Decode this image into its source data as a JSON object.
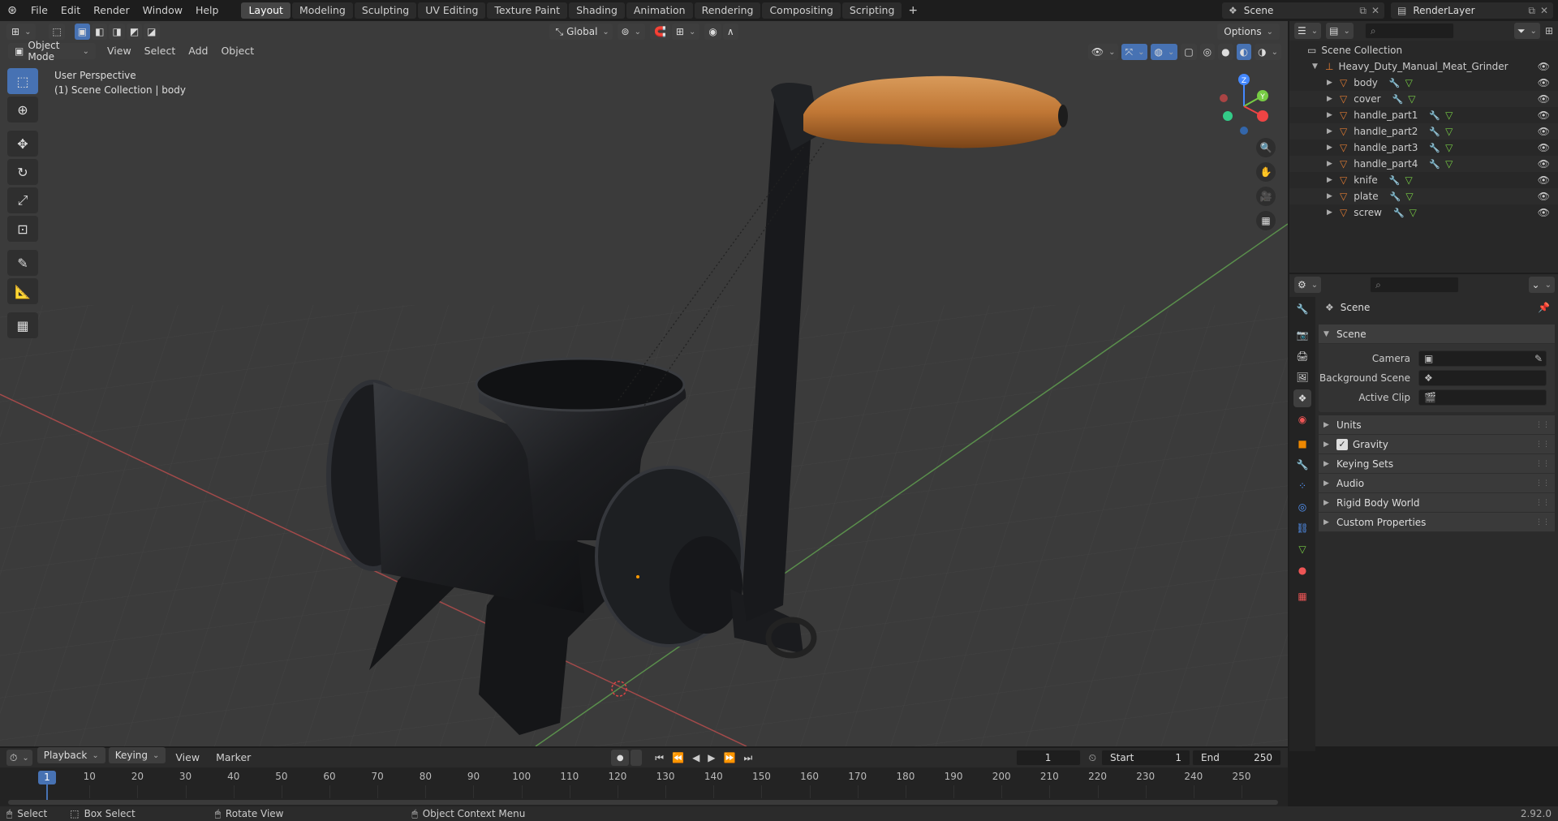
{
  "topbar": {
    "menus": [
      "File",
      "Edit",
      "Render",
      "Window",
      "Help"
    ],
    "workspaces": [
      "Layout",
      "Modeling",
      "Sculpting",
      "UV Editing",
      "Texture Paint",
      "Shading",
      "Animation",
      "Rendering",
      "Compositing",
      "Scripting"
    ],
    "active_workspace": "Layout",
    "add_tab": "+",
    "scene": "Scene",
    "view_layer": "RenderLayer"
  },
  "viewport": {
    "mode": "Object Mode",
    "menus": [
      "View",
      "Select",
      "Add",
      "Object"
    ],
    "orientation": "Global",
    "options": "Options",
    "info_line1": "User Perspective",
    "info_line2": "(1) Scene Collection | body",
    "gizmo": {
      "z": "Z",
      "y": "Y"
    }
  },
  "outliner": {
    "root": "Scene Collection",
    "collection": "Heavy_Duty_Manual_Meat_Grinder",
    "objects": [
      "body",
      "cover",
      "handle_part1",
      "handle_part2",
      "handle_part3",
      "handle_part4",
      "knife",
      "plate",
      "screw"
    ]
  },
  "properties": {
    "context": "Scene",
    "panel": "Scene",
    "fields": [
      {
        "label": "Camera"
      },
      {
        "label": "Background Scene"
      },
      {
        "label": "Active Clip"
      }
    ],
    "subpanels": [
      {
        "label": "Units",
        "check": false
      },
      {
        "label": "Gravity",
        "check": true
      },
      {
        "label": "Keying Sets",
        "check": false
      },
      {
        "label": "Audio",
        "check": false
      },
      {
        "label": "Rigid Body World",
        "check": false
      },
      {
        "label": "Custom Properties",
        "check": false
      }
    ]
  },
  "timeline": {
    "menus": [
      "Playback",
      "Keying",
      "View",
      "Marker"
    ],
    "current_frame": "1",
    "start_label": "Start",
    "start": "1",
    "end_label": "End",
    "end": "250",
    "ticks": [
      "10",
      "20",
      "30",
      "40",
      "50",
      "60",
      "70",
      "80",
      "90",
      "100",
      "110",
      "120",
      "130",
      "140",
      "150",
      "160",
      "170",
      "180",
      "190",
      "200",
      "210",
      "220",
      "230",
      "240",
      "250"
    ],
    "playhead": "1"
  },
  "statusbar": {
    "select": "Select",
    "box_select": "Box Select",
    "rotate": "Rotate View",
    "context_menu": "Object Context Menu",
    "version": "2.92.0"
  },
  "colors": {
    "accent": "#4772b3",
    "selected": "#e07b32",
    "axis_x": "#e44",
    "axis_y": "#7c4",
    "axis_z": "#48f"
  }
}
